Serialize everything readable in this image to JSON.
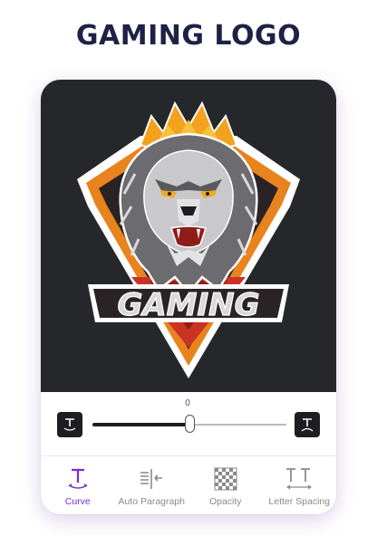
{
  "headline": {
    "part1": "GAMING",
    "part2": "LOGO"
  },
  "logo": {
    "text": "GAMING"
  },
  "slider": {
    "value_label": "0",
    "value": 0.5
  },
  "toolbar": {
    "items": [
      {
        "label": "Curve",
        "icon": "curve-text-icon",
        "active": true
      },
      {
        "label": "Auto Paragraph",
        "icon": "auto-paragraph-icon",
        "active": false
      },
      {
        "label": "Opacity",
        "icon": "opacity-checker-icon",
        "active": false
      },
      {
        "label": "Letter Spacing",
        "icon": "letter-spacing-icon",
        "active": false
      }
    ]
  },
  "colors": {
    "headline": "#1d2245",
    "accent": "#7b2fd6",
    "canvas_bg": "#26272b",
    "logo_orange": "#e8831e",
    "logo_red": "#c93324"
  }
}
